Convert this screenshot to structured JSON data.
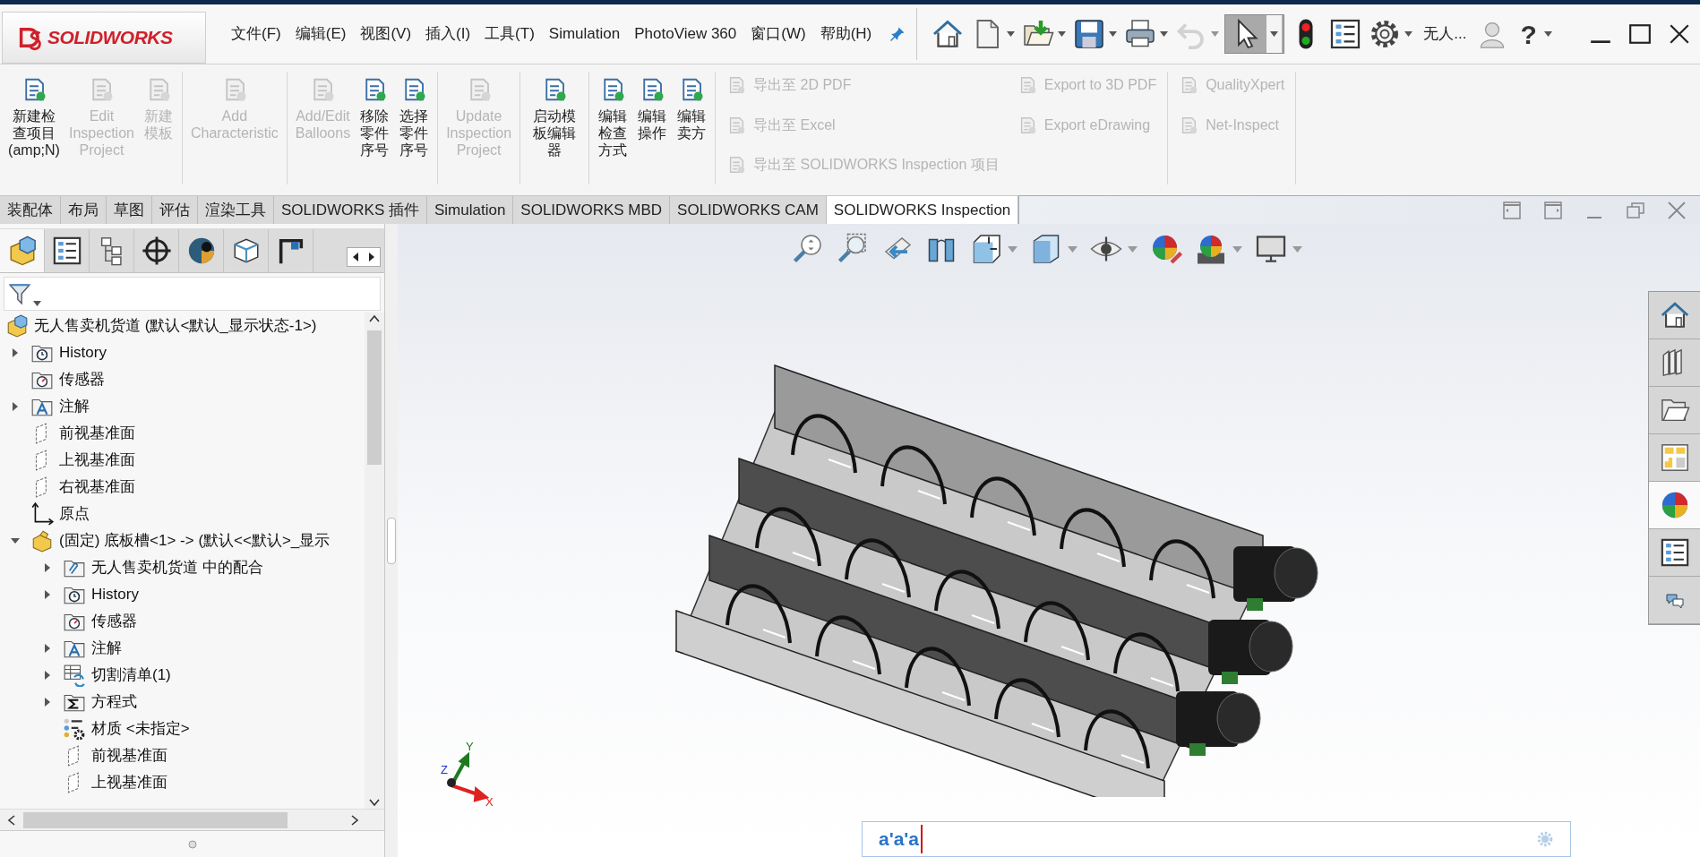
{
  "menu_bar": {
    "logo": "SOLIDWORKS",
    "items": [
      "文件(F)",
      "编辑(E)",
      "视图(V)",
      "插入(I)",
      "工具(T)",
      "Simulation",
      "PhotoView 360",
      "窗口(W)",
      "帮助(H)"
    ],
    "user_name": "无人...",
    "help_glyph": "?"
  },
  "quick_access": [
    {
      "kind": "home",
      "dropdown": false,
      "disabled": false,
      "selected": false
    },
    {
      "kind": "new",
      "dropdown": true,
      "disabled": false,
      "selected": false
    },
    {
      "kind": "open",
      "dropdown": true,
      "disabled": false,
      "selected": false
    },
    {
      "kind": "save",
      "dropdown": true,
      "disabled": false,
      "selected": false
    },
    {
      "kind": "print",
      "dropdown": true,
      "disabled": false,
      "selected": false
    },
    {
      "kind": "undo",
      "dropdown": true,
      "disabled": true,
      "selected": false
    },
    {
      "kind": "select",
      "dropdown": true,
      "disabled": false,
      "selected": true
    },
    {
      "kind": "rebuild",
      "dropdown": false,
      "disabled": false,
      "selected": false
    },
    {
      "kind": "file-properties",
      "dropdown": false,
      "disabled": false,
      "selected": false
    },
    {
      "kind": "options",
      "dropdown": true,
      "disabled": false,
      "selected": false
    }
  ],
  "ribbon": [
    {
      "kind": "large",
      "buttons": [
        {
          "label": "新建检查项目(amp;N)",
          "disabled": false
        },
        {
          "label": "Edit\nInspection\nProject",
          "disabled": true
        },
        {
          "label": "新建模板",
          "disabled": true
        }
      ]
    },
    {
      "kind": "large",
      "buttons": [
        {
          "label": "Add\nCharacteristic",
          "disabled": true
        }
      ]
    },
    {
      "kind": "large",
      "buttons": [
        {
          "label": "Add/Edit\nBalloons",
          "disabled": true
        },
        {
          "label": "移除零件序号",
          "disabled": false
        },
        {
          "label": "选择零件序号",
          "disabled": false
        }
      ]
    },
    {
      "kind": "large",
      "buttons": [
        {
          "label": "Update\nInspection\nProject",
          "disabled": true
        }
      ]
    },
    {
      "kind": "large",
      "buttons": [
        {
          "label": "启动模板编辑器",
          "disabled": false
        }
      ]
    },
    {
      "kind": "large",
      "buttons": [
        {
          "label": "编辑检查方式",
          "disabled": false
        },
        {
          "label": "编辑操作",
          "disabled": false
        },
        {
          "label": "编辑卖方",
          "disabled": false
        }
      ]
    },
    {
      "kind": "small",
      "buttons": [
        {
          "label": "导出至 2D PDF",
          "disabled": true
        },
        {
          "label": "导出至 Excel",
          "disabled": true
        },
        {
          "label": "导出至 SOLIDWORKS Inspection 项目",
          "disabled": true
        },
        {
          "label": "Export to 3D PDF",
          "disabled": true
        },
        {
          "label": "Export eDrawing",
          "disabled": true
        }
      ]
    },
    {
      "kind": "small",
      "buttons": [
        {
          "label": "QualityXpert",
          "disabled": true
        },
        {
          "label": "Net-Inspect",
          "disabled": true
        }
      ]
    }
  ],
  "command_tabs": [
    {
      "label": "装配体",
      "selected": false
    },
    {
      "label": "布局",
      "selected": false
    },
    {
      "label": "草图",
      "selected": false
    },
    {
      "label": "评估",
      "selected": false
    },
    {
      "label": "渲染工具",
      "selected": false
    },
    {
      "label": "SOLIDWORKS 插件",
      "selected": false
    },
    {
      "label": "Simulation",
      "selected": false
    },
    {
      "label": "SOLIDWORKS MBD",
      "selected": false
    },
    {
      "label": "SOLIDWORKS CAM",
      "selected": false
    },
    {
      "label": "SOLIDWORKS Inspection",
      "selected": true
    }
  ],
  "feature_manager": {
    "panel_tabs": [
      {
        "kind": "feature-tree",
        "selected": true
      },
      {
        "kind": "property",
        "selected": false
      },
      {
        "kind": "configuration",
        "selected": false
      },
      {
        "kind": "dimxpert",
        "selected": false
      },
      {
        "kind": "appearance",
        "selected": false
      },
      {
        "kind": "cam",
        "selected": false
      },
      {
        "kind": "cam-tree",
        "selected": false
      }
    ],
    "tree": [
      {
        "label": "无人售卖机货道  (默认<默认_显示状态-1>)",
        "kind": "assembly",
        "children": [
          {
            "label": "History",
            "kind": "history",
            "expanded": false
          },
          {
            "label": "传感器",
            "kind": "sensor"
          },
          {
            "label": "注解",
            "kind": "annotation",
            "expanded": false
          },
          {
            "label": "前视基准面",
            "kind": "plane"
          },
          {
            "label": "上视基准面",
            "kind": "plane"
          },
          {
            "label": "右视基准面",
            "kind": "plane"
          },
          {
            "label": "原点",
            "kind": "origin"
          },
          {
            "label": "(固定) 底板槽<1> -> (默认<<默认>_显示",
            "kind": "part",
            "expanded": true,
            "children": [
              {
                "label": "无人售卖机货道 中的配合",
                "kind": "mates",
                "expanded": false
              },
              {
                "label": "History",
                "kind": "history",
                "expanded": false
              },
              {
                "label": "传感器",
                "kind": "sensor"
              },
              {
                "label": "注解",
                "kind": "annotation",
                "expanded": false
              },
              {
                "label": "切割清单(1)",
                "kind": "cutlist",
                "expanded": false
              },
              {
                "label": "方程式",
                "kind": "equations",
                "expanded": false
              },
              {
                "label": "材质 <未指定>",
                "kind": "material"
              },
              {
                "label": "前视基准面",
                "kind": "plane"
              },
              {
                "label": "上视基准面",
                "kind": "plane"
              }
            ]
          }
        ]
      }
    ]
  },
  "task_pane": [
    {
      "kind": "resources",
      "selected": false
    },
    {
      "kind": "design-library",
      "selected": false
    },
    {
      "kind": "file-explorer",
      "selected": false
    },
    {
      "kind": "view-palette",
      "selected": false
    },
    {
      "kind": "appearances",
      "selected": true
    },
    {
      "kind": "custom-properties",
      "selected": false
    },
    {
      "kind": "forum",
      "selected": false
    }
  ],
  "triad": {
    "x_label": "X",
    "y_label": "Y",
    "z_label": "Z"
  },
  "command_search": {
    "value": "a'a'a"
  }
}
